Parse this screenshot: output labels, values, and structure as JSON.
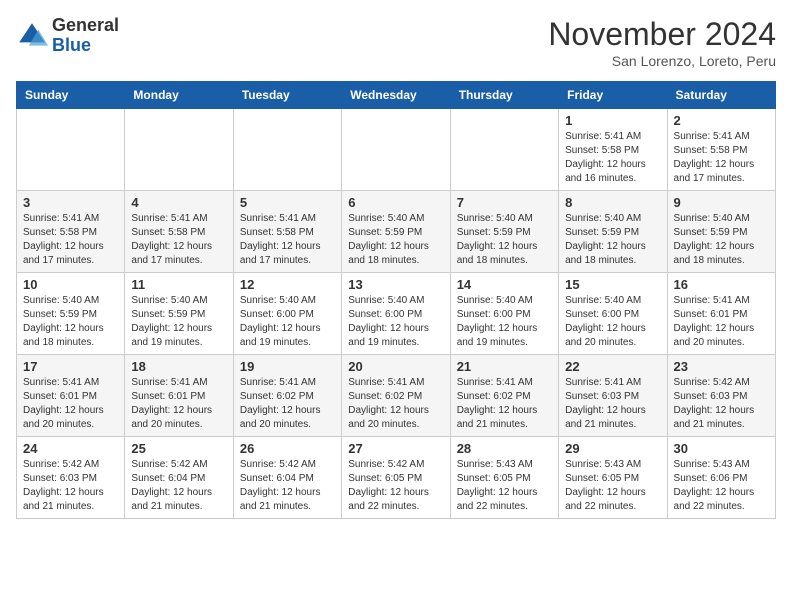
{
  "header": {
    "logo": {
      "general": "General",
      "blue": "Blue"
    },
    "title": "November 2024",
    "location": "San Lorenzo, Loreto, Peru"
  },
  "weekdays": [
    "Sunday",
    "Monday",
    "Tuesday",
    "Wednesday",
    "Thursday",
    "Friday",
    "Saturday"
  ],
  "weeks": [
    [
      {
        "day": "",
        "info": ""
      },
      {
        "day": "",
        "info": ""
      },
      {
        "day": "",
        "info": ""
      },
      {
        "day": "",
        "info": ""
      },
      {
        "day": "",
        "info": ""
      },
      {
        "day": "1",
        "info": "Sunrise: 5:41 AM\nSunset: 5:58 PM\nDaylight: 12 hours and 16 minutes."
      },
      {
        "day": "2",
        "info": "Sunrise: 5:41 AM\nSunset: 5:58 PM\nDaylight: 12 hours and 17 minutes."
      }
    ],
    [
      {
        "day": "3",
        "info": "Sunrise: 5:41 AM\nSunset: 5:58 PM\nDaylight: 12 hours and 17 minutes."
      },
      {
        "day": "4",
        "info": "Sunrise: 5:41 AM\nSunset: 5:58 PM\nDaylight: 12 hours and 17 minutes."
      },
      {
        "day": "5",
        "info": "Sunrise: 5:41 AM\nSunset: 5:58 PM\nDaylight: 12 hours and 17 minutes."
      },
      {
        "day": "6",
        "info": "Sunrise: 5:40 AM\nSunset: 5:59 PM\nDaylight: 12 hours and 18 minutes."
      },
      {
        "day": "7",
        "info": "Sunrise: 5:40 AM\nSunset: 5:59 PM\nDaylight: 12 hours and 18 minutes."
      },
      {
        "day": "8",
        "info": "Sunrise: 5:40 AM\nSunset: 5:59 PM\nDaylight: 12 hours and 18 minutes."
      },
      {
        "day": "9",
        "info": "Sunrise: 5:40 AM\nSunset: 5:59 PM\nDaylight: 12 hours and 18 minutes."
      }
    ],
    [
      {
        "day": "10",
        "info": "Sunrise: 5:40 AM\nSunset: 5:59 PM\nDaylight: 12 hours and 18 minutes."
      },
      {
        "day": "11",
        "info": "Sunrise: 5:40 AM\nSunset: 5:59 PM\nDaylight: 12 hours and 19 minutes."
      },
      {
        "day": "12",
        "info": "Sunrise: 5:40 AM\nSunset: 6:00 PM\nDaylight: 12 hours and 19 minutes."
      },
      {
        "day": "13",
        "info": "Sunrise: 5:40 AM\nSunset: 6:00 PM\nDaylight: 12 hours and 19 minutes."
      },
      {
        "day": "14",
        "info": "Sunrise: 5:40 AM\nSunset: 6:00 PM\nDaylight: 12 hours and 19 minutes."
      },
      {
        "day": "15",
        "info": "Sunrise: 5:40 AM\nSunset: 6:00 PM\nDaylight: 12 hours and 20 minutes."
      },
      {
        "day": "16",
        "info": "Sunrise: 5:41 AM\nSunset: 6:01 PM\nDaylight: 12 hours and 20 minutes."
      }
    ],
    [
      {
        "day": "17",
        "info": "Sunrise: 5:41 AM\nSunset: 6:01 PM\nDaylight: 12 hours and 20 minutes."
      },
      {
        "day": "18",
        "info": "Sunrise: 5:41 AM\nSunset: 6:01 PM\nDaylight: 12 hours and 20 minutes."
      },
      {
        "day": "19",
        "info": "Sunrise: 5:41 AM\nSunset: 6:02 PM\nDaylight: 12 hours and 20 minutes."
      },
      {
        "day": "20",
        "info": "Sunrise: 5:41 AM\nSunset: 6:02 PM\nDaylight: 12 hours and 20 minutes."
      },
      {
        "day": "21",
        "info": "Sunrise: 5:41 AM\nSunset: 6:02 PM\nDaylight: 12 hours and 21 minutes."
      },
      {
        "day": "22",
        "info": "Sunrise: 5:41 AM\nSunset: 6:03 PM\nDaylight: 12 hours and 21 minutes."
      },
      {
        "day": "23",
        "info": "Sunrise: 5:42 AM\nSunset: 6:03 PM\nDaylight: 12 hours and 21 minutes."
      }
    ],
    [
      {
        "day": "24",
        "info": "Sunrise: 5:42 AM\nSunset: 6:03 PM\nDaylight: 12 hours and 21 minutes."
      },
      {
        "day": "25",
        "info": "Sunrise: 5:42 AM\nSunset: 6:04 PM\nDaylight: 12 hours and 21 minutes."
      },
      {
        "day": "26",
        "info": "Sunrise: 5:42 AM\nSunset: 6:04 PM\nDaylight: 12 hours and 21 minutes."
      },
      {
        "day": "27",
        "info": "Sunrise: 5:42 AM\nSunset: 6:05 PM\nDaylight: 12 hours and 22 minutes."
      },
      {
        "day": "28",
        "info": "Sunrise: 5:43 AM\nSunset: 6:05 PM\nDaylight: 12 hours and 22 minutes."
      },
      {
        "day": "29",
        "info": "Sunrise: 5:43 AM\nSunset: 6:05 PM\nDaylight: 12 hours and 22 minutes."
      },
      {
        "day": "30",
        "info": "Sunrise: 5:43 AM\nSunset: 6:06 PM\nDaylight: 12 hours and 22 minutes."
      }
    ]
  ]
}
